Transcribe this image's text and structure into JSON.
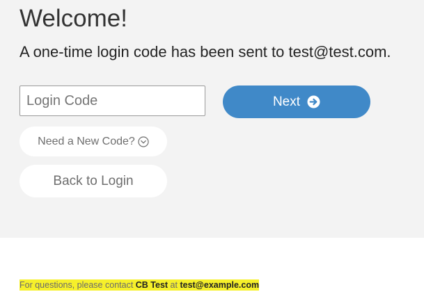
{
  "header": {
    "title": "Welcome!",
    "message": "A one-time login code has been sent to test@test.com."
  },
  "form": {
    "code_placeholder": "Login Code",
    "code_value": "",
    "next_label": "Next",
    "next_icon": "arrow-right-circle-icon",
    "new_code_label": "Need a New Code?",
    "new_code_icon": "chevron-down-circle-icon",
    "back_label": "Back to Login"
  },
  "footer": {
    "prefix": "For questions, please contact ",
    "contact_name": "CB Test",
    "middle": " at ",
    "contact_email": "test@example.com",
    "highlight_color": "#f6f02a"
  },
  "colors": {
    "accent": "#4089c8",
    "panel_bg": "#f3f3f3"
  }
}
